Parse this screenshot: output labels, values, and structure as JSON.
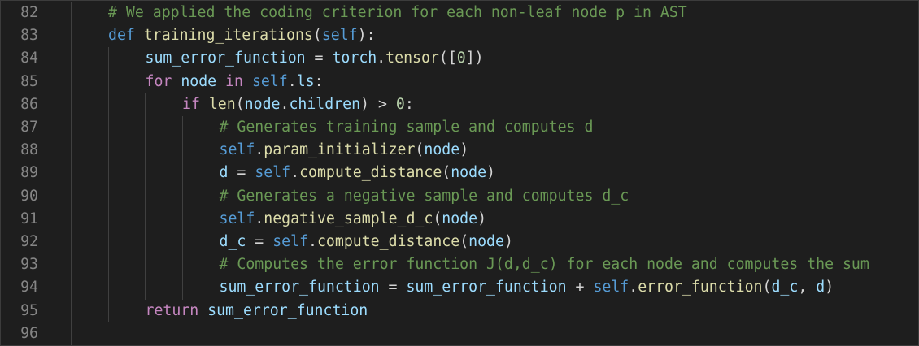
{
  "editor": {
    "background": "#1e1e1e",
    "colors": {
      "comment": "#6a9955",
      "keyword": "#569cd6",
      "control": "#c586c0",
      "function": "#dcdcaa",
      "variable": "#9cdcfe",
      "number": "#b5cea8",
      "line_number": "#858585"
    },
    "lines": [
      {
        "number": "82",
        "indent": 1,
        "tokens": [
          {
            "t": "# We applied the coding criterion for each non-leaf node p in AST",
            "c": "cm"
          }
        ]
      },
      {
        "number": "83",
        "indent": 1,
        "tokens": [
          {
            "t": "def",
            "c": "kw"
          },
          {
            "t": " ",
            "c": "op"
          },
          {
            "t": "training_iterations",
            "c": "fn"
          },
          {
            "t": "(",
            "c": "op"
          },
          {
            "t": "self",
            "c": "kw"
          },
          {
            "t": "):",
            "c": "op"
          }
        ]
      },
      {
        "number": "84",
        "indent": 2,
        "tokens": [
          {
            "t": "sum_error_function",
            "c": "vr"
          },
          {
            "t": " = ",
            "c": "op"
          },
          {
            "t": "torch",
            "c": "vr"
          },
          {
            "t": ".",
            "c": "op"
          },
          {
            "t": "tensor",
            "c": "fn"
          },
          {
            "t": "([",
            "c": "op"
          },
          {
            "t": "0",
            "c": "nm"
          },
          {
            "t": "])",
            "c": "op"
          }
        ]
      },
      {
        "number": "85",
        "indent": 2,
        "tokens": [
          {
            "t": "for",
            "c": "fl"
          },
          {
            "t": " ",
            "c": "op"
          },
          {
            "t": "node",
            "c": "vr"
          },
          {
            "t": " ",
            "c": "op"
          },
          {
            "t": "in",
            "c": "fl"
          },
          {
            "t": " ",
            "c": "op"
          },
          {
            "t": "self",
            "c": "kw"
          },
          {
            "t": ".",
            "c": "op"
          },
          {
            "t": "ls",
            "c": "vr"
          },
          {
            "t": ":",
            "c": "op"
          }
        ]
      },
      {
        "number": "86",
        "indent": 3,
        "tokens": [
          {
            "t": "if",
            "c": "fl"
          },
          {
            "t": " ",
            "c": "op"
          },
          {
            "t": "len",
            "c": "fn"
          },
          {
            "t": "(",
            "c": "op"
          },
          {
            "t": "node",
            "c": "vr"
          },
          {
            "t": ".",
            "c": "op"
          },
          {
            "t": "children",
            "c": "vr"
          },
          {
            "t": ") > ",
            "c": "op"
          },
          {
            "t": "0",
            "c": "nm"
          },
          {
            "t": ":",
            "c": "op"
          }
        ]
      },
      {
        "number": "87",
        "indent": 4,
        "tokens": [
          {
            "t": "# Generates training sample and computes d",
            "c": "cm"
          }
        ]
      },
      {
        "number": "88",
        "indent": 4,
        "tokens": [
          {
            "t": "self",
            "c": "kw"
          },
          {
            "t": ".",
            "c": "op"
          },
          {
            "t": "param_initializer",
            "c": "fn"
          },
          {
            "t": "(",
            "c": "op"
          },
          {
            "t": "node",
            "c": "vr"
          },
          {
            "t": ")",
            "c": "op"
          }
        ]
      },
      {
        "number": "89",
        "indent": 4,
        "tokens": [
          {
            "t": "d",
            "c": "vr"
          },
          {
            "t": " = ",
            "c": "op"
          },
          {
            "t": "self",
            "c": "kw"
          },
          {
            "t": ".",
            "c": "op"
          },
          {
            "t": "compute_distance",
            "c": "fn"
          },
          {
            "t": "(",
            "c": "op"
          },
          {
            "t": "node",
            "c": "vr"
          },
          {
            "t": ")",
            "c": "op"
          }
        ]
      },
      {
        "number": "90",
        "indent": 4,
        "tokens": [
          {
            "t": "# Generates a negative sample and computes d_c",
            "c": "cm"
          }
        ]
      },
      {
        "number": "91",
        "indent": 4,
        "tokens": [
          {
            "t": "self",
            "c": "kw"
          },
          {
            "t": ".",
            "c": "op"
          },
          {
            "t": "negative_sample_d_c",
            "c": "fn"
          },
          {
            "t": "(",
            "c": "op"
          },
          {
            "t": "node",
            "c": "vr"
          },
          {
            "t": ")",
            "c": "op"
          }
        ]
      },
      {
        "number": "92",
        "indent": 4,
        "tokens": [
          {
            "t": "d_c",
            "c": "vr"
          },
          {
            "t": " = ",
            "c": "op"
          },
          {
            "t": "self",
            "c": "kw"
          },
          {
            "t": ".",
            "c": "op"
          },
          {
            "t": "compute_distance",
            "c": "fn"
          },
          {
            "t": "(",
            "c": "op"
          },
          {
            "t": "node",
            "c": "vr"
          },
          {
            "t": ")",
            "c": "op"
          }
        ]
      },
      {
        "number": "93",
        "indent": 4,
        "tokens": [
          {
            "t": "# Computes the error function J(d,d_c) for each node and computes the sum",
            "c": "cm"
          }
        ]
      },
      {
        "number": "94",
        "indent": 4,
        "tokens": [
          {
            "t": "sum_error_function",
            "c": "vr"
          },
          {
            "t": " = ",
            "c": "op"
          },
          {
            "t": "sum_error_function",
            "c": "vr"
          },
          {
            "t": " + ",
            "c": "op"
          },
          {
            "t": "self",
            "c": "kw"
          },
          {
            "t": ".",
            "c": "op"
          },
          {
            "t": "error_function",
            "c": "fn"
          },
          {
            "t": "(",
            "c": "op"
          },
          {
            "t": "d_c",
            "c": "vr"
          },
          {
            "t": ", ",
            "c": "op"
          },
          {
            "t": "d",
            "c": "vr"
          },
          {
            "t": ")",
            "c": "op"
          }
        ]
      },
      {
        "number": "95",
        "indent": 2,
        "tokens": [
          {
            "t": "return",
            "c": "fl"
          },
          {
            "t": " ",
            "c": "op"
          },
          {
            "t": "sum_error_function",
            "c": "vr"
          }
        ]
      },
      {
        "number": "96",
        "indent": 0,
        "tokens": []
      }
    ]
  }
}
